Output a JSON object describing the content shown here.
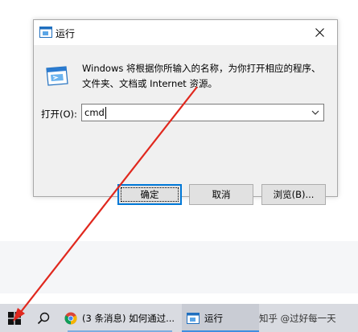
{
  "dialog": {
    "title": "运行",
    "description": "Windows 将根据你所输入的名称，为你打开相应的程序、文件夹、文档或 Internet 资源。",
    "open_label": "打开(O):",
    "input_value": "cmd",
    "ok_label": "确定",
    "cancel_label": "取消",
    "browse_label": "浏览(B)..."
  },
  "taskbar": {
    "chrome_item": "(3 条消息) 如何通过...",
    "run_item": "运行",
    "watermark": "知乎 @过好每一天"
  },
  "colors": {
    "accent": "#0078d7",
    "arrow": "#e0281e",
    "taskbar": "#d9dbe1"
  }
}
